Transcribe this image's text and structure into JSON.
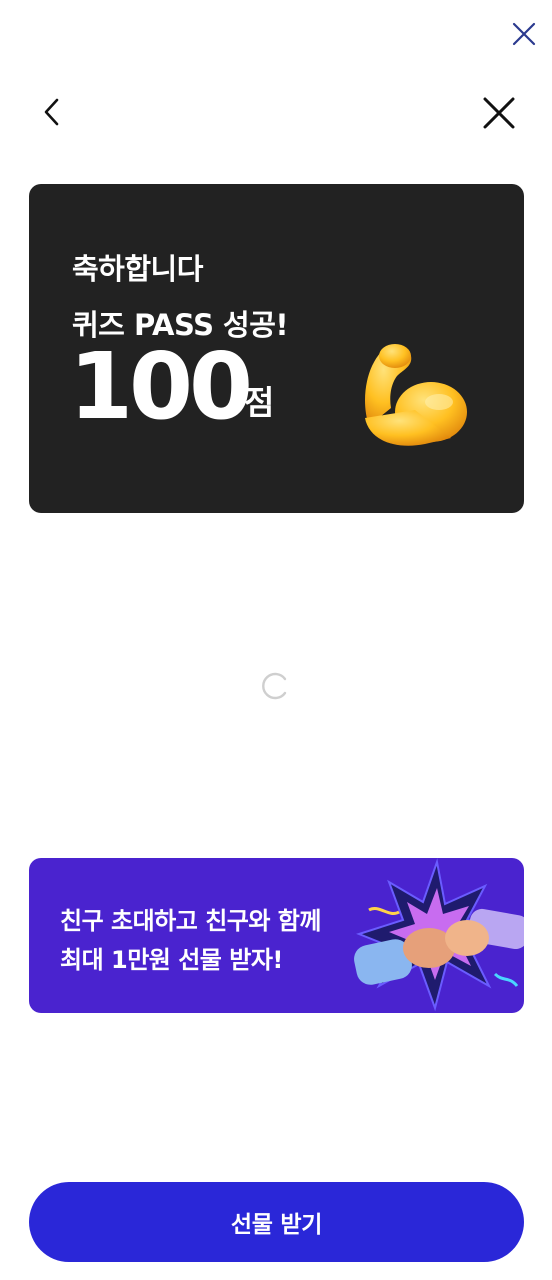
{
  "header": {
    "top_close_icon": "close-icon",
    "back_icon": "chevron-left-icon",
    "close_icon": "close-icon"
  },
  "score_card": {
    "line1": "축하합니다",
    "line2": "퀴즈 PASS 성공!",
    "score": "100",
    "unit": "점",
    "icon": "flexed-biceps-icon",
    "background": "#222222"
  },
  "loading": {
    "icon": "spinner-icon"
  },
  "banner": {
    "line1": "친구 초대하고 친구와 함께",
    "line2": "최대 1만원 선물 받자!",
    "art": "fist-bump-illustration",
    "background": "#4a23cf"
  },
  "cta": {
    "label": "선물 받기",
    "background": "#2a27d8"
  }
}
